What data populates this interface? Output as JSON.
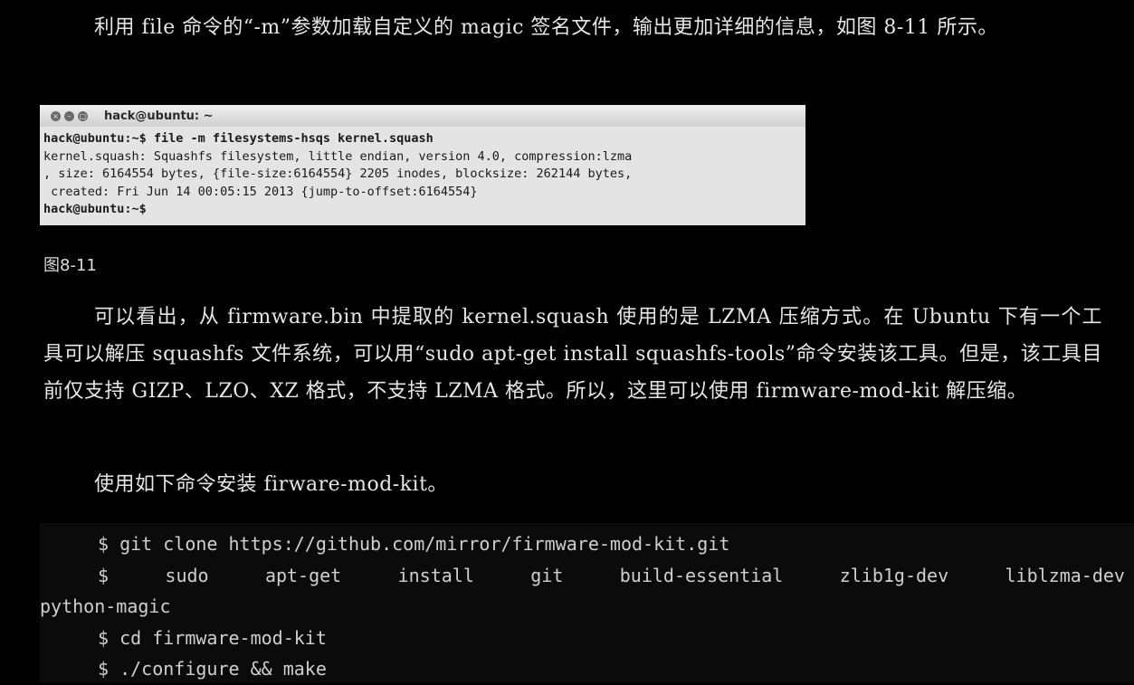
{
  "para1": "利用 file 命令的“-m”参数加载自定义的 magic 签名文件，输出更加详细的信息，如图 8-11 所示。",
  "terminal": {
    "title": "hack@ubuntu: ~",
    "lines": [
      "hack@ubuntu:~$ file -m filesystems-hsqs kernel.squash",
      "kernel.squash: Squashfs filesystem, little endian, version 4.0, compression:lzma",
      ", size: 6164554 bytes, {file-size:6164554} 2205 inodes, blocksize: 262144 bytes,",
      " created: Fri Jun 14 00:05:15 2013 {jump-to-offset:6164554}",
      "hack@ubuntu:~$"
    ]
  },
  "caption": "图8-11",
  "para2": "可以看出，从 firmware.bin 中提取的 kernel.squash 使用的是 LZMA 压缩方式。在 Ubuntu 下有一个工具可以解压 squashfs 文件系统，可以用“sudo apt-get install squashfs-tools”命令安装该工具。但是，该工具目前仅支持 GIZP、LZO、XZ 格式，不支持 LZMA 格式。所以，这里可以使用 firmware-mod-kit 解压缩。",
  "para3": "使用如下命令安装 firware-mod-kit。",
  "code": {
    "line1": "$ git clone https://github.com/mirror/firmware-mod-kit.git",
    "line2_words": [
      "$",
      "sudo",
      "apt-get",
      "install",
      "git",
      "build-essential",
      "zlib1g-dev",
      "liblzma-dev"
    ],
    "line3": "python-magic",
    "line4": "$ cd firmware-mod-kit",
    "line5": "$ ./configure && make"
  }
}
